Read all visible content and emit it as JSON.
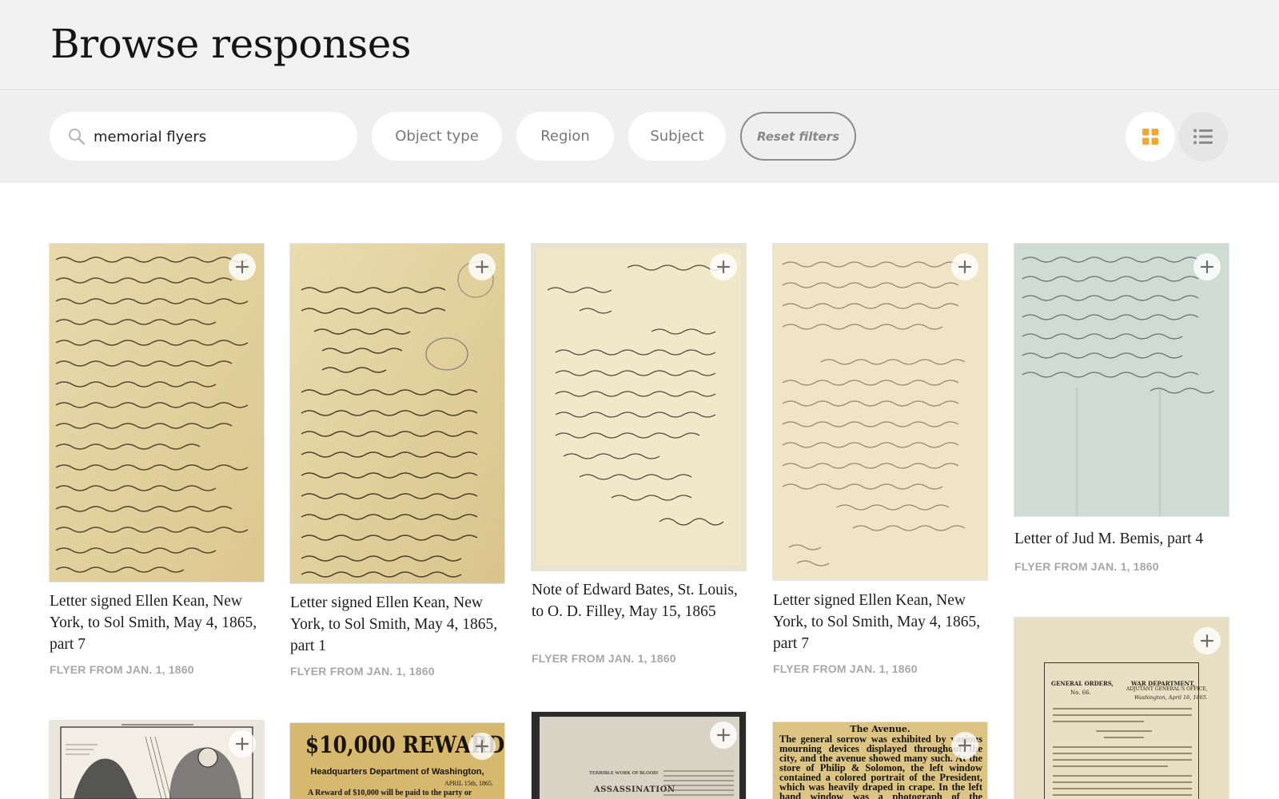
{
  "page": {
    "title": "Browse responses"
  },
  "filters": {
    "search_value": "memorial flyers",
    "object_type": "Object type",
    "region": "Region",
    "subject": "Subject",
    "reset": "Reset filters"
  },
  "view": {
    "grid_icon": "grid-icon",
    "list_icon": "list-icon",
    "active": "grid",
    "accent": "#f0a830"
  },
  "items": [
    {
      "title": "Letter signed Ellen Kean, New York, to Sol Smith, May 4, 1865, part 7",
      "meta": "FLYER FROM JAN. 1, 1860"
    },
    {
      "title": "Letter signed Ellen Kean, New York, to Sol Smith, May 4, 1865, part 1",
      "meta": "FLYER FROM JAN. 1, 1860"
    },
    {
      "title": "Note of Edward Bates, St. Louis, to O. D. Filley, May 15, 1865",
      "meta": "FLYER FROM JAN. 1, 1860"
    },
    {
      "title": "Letter signed Ellen Kean, New York, to Sol Smith, May 4, 1865, part 7",
      "meta": "FLYER FROM JAN. 1, 1860"
    },
    {
      "title": "Letter of Jud M. Bemis, part 4",
      "meta": "FLYER FROM JAN. 1, 1860"
    }
  ],
  "posters": {
    "reward_headline": "$10,000 REWARD",
    "reward_sub": "Headquarters Department of Washington,",
    "reward_date": "APRIL 15th, 1865.",
    "reward_body": "A Reward of $10,000 will be paid to the party or",
    "assassination": "ASSASSINATION",
    "terrible": "TERRIBLE WORK OF BLOOD!",
    "avenue_head": "The Avenue.",
    "avenue_text": "The general sorrow was exhibited by various mourning devices displayed throughout the city, and the avenue showed many such. At the store of Philip & Solomon, the left window contained a colored portrait of the President, which was heavily draped in crape. In the left hand window was a photograph of the President and his son Tad. This was the",
    "orders_head": "GENERAL ORDERS,",
    "orders_no": "No. 66.",
    "orders_dept": "WAR DEPARTMENT,",
    "orders_office": "ADJUTANT GENERAL'S OFFICE,",
    "orders_place": "Washington, April 16, 1865."
  }
}
